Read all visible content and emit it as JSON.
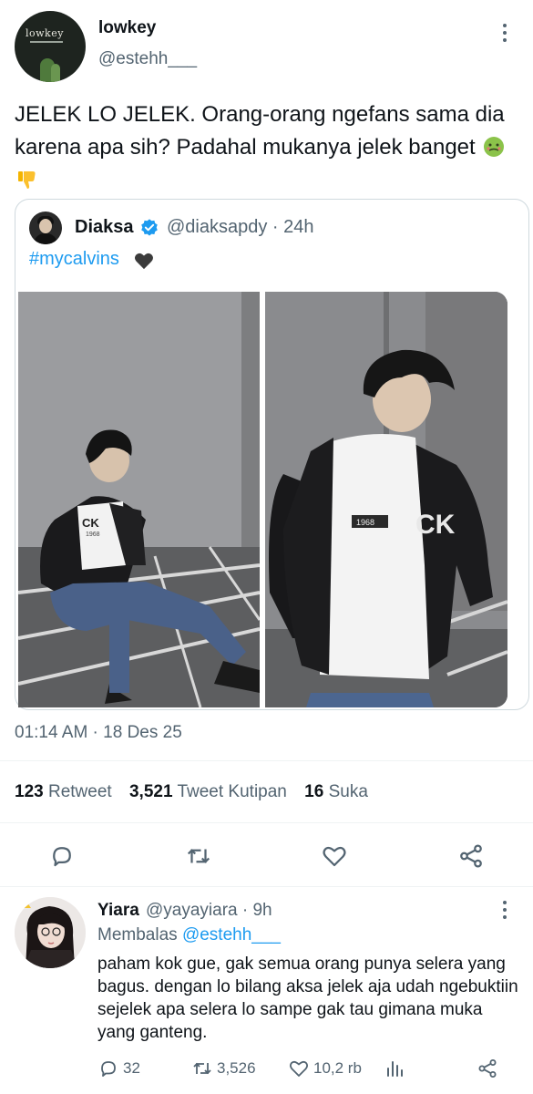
{
  "tweet": {
    "author_name": "lowkey",
    "author_handle": "@estehh___",
    "avatar_text": "lowkey",
    "text": "JELEK LO JELEK. Orang-orang ngefans sama dia karena apa sih? Padahal mukanya jelek banget",
    "emojis": [
      "nauseated-face-emoji",
      "thumbs-down-emoji"
    ],
    "timestamp": "01:14 AM · 18 Des 25"
  },
  "quoted": {
    "author_name": "Diaksa",
    "author_handle": "@diaksapdy · 24h",
    "text": "#mycalvins",
    "photos": [
      {
        "label": "photo-seated",
        "jacket_mark": "CK",
        "year": "1968"
      },
      {
        "label": "photo-standing",
        "jacket_mark": "CK",
        "year": "1968"
      }
    ]
  },
  "stats": {
    "retweets_count": "123",
    "retweets_label": "Retweet",
    "quotes_count": "3,521",
    "quotes_label": "Tweet Kutipan",
    "likes_count": "16",
    "likes_label": "Suka"
  },
  "actions": [
    "reply-icon",
    "retweet-icon",
    "like-icon",
    "share-icon"
  ],
  "reply": {
    "author_name": "Yiara",
    "author_handle": "@yayayiara · 9h",
    "replying_prefix": "Membalas",
    "replying_to": "@estehh___",
    "text": "paham kok gue, gak semua orang punya selera yang bagus. dengan lo bilang aksa jelek aja udah ngebuktiin sejelek apa selera lo sampe gak tau gimana muka yang ganteng.",
    "reply_count": "32",
    "retweet_count": "3,526",
    "like_count": "10,2 rb"
  },
  "colors": {
    "accent": "#1d9bf0",
    "secondary_text": "#536471",
    "primary_text": "#0f1419",
    "border": "#cfd9de"
  }
}
